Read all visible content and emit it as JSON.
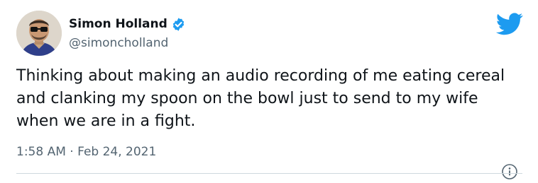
{
  "tweet": {
    "author": {
      "display_name": "Simon Holland",
      "handle": "@simoncholland",
      "verified": true
    },
    "text": "Thinking about making an audio recording of me eating cereal and clanking my spoon on the bowl just to send to my wife when we are in a fight.",
    "time": "1:58 AM",
    "separator": "·",
    "date": "Feb 24, 2021"
  },
  "icons": {
    "platform": "twitter-bird-icon",
    "verified": "verified-badge-icon",
    "info": "info-icon"
  },
  "colors": {
    "brand_blue": "#1d9bf0",
    "text_primary": "#0f1419",
    "text_secondary": "#536471",
    "divider": "#cfd9de"
  }
}
